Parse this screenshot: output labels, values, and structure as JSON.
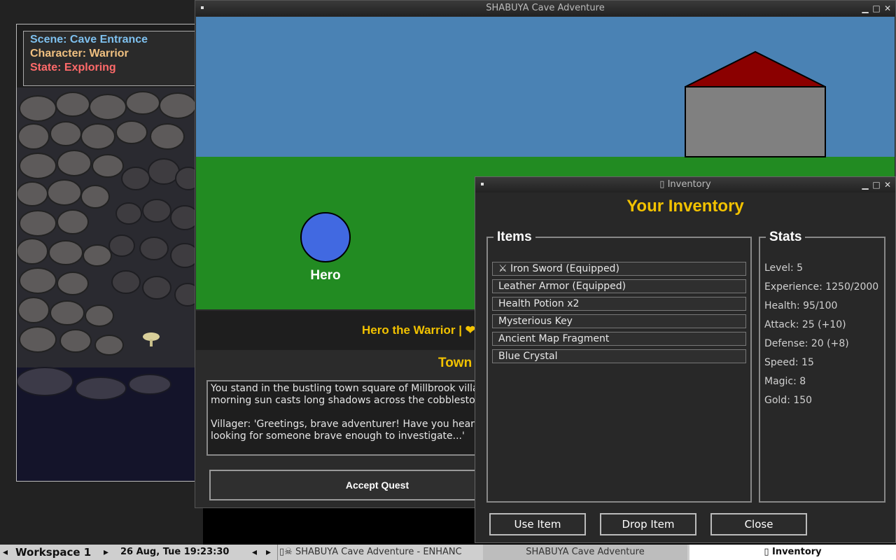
{
  "cave_panel": {
    "scene_line": "Scene: Cave Entrance",
    "character_line": "Character: Warrior",
    "state_line": "State: Exploring"
  },
  "main_window": {
    "title": "SHABUYA Cave Adventure",
    "hero_label": "Hero",
    "status_line": "Hero the Warrior | ❤",
    "location_title": "Town",
    "story_text": "You stand in the bustling town square of Millbrook villag\nmorning sun casts long shadows across the cobblestor\n\nVillager: 'Greetings, brave adventurer! Have you heard\nlooking for someone brave enough to investigate...'",
    "accept_button": "Accept Quest"
  },
  "inventory_window": {
    "title": "▯ Inventory",
    "heading": "Your Inventory",
    "items_legend": "Items",
    "items": [
      "⚔ Iron Sword (Equipped)",
      "Leather Armor (Equipped)",
      "Health Potion x2",
      "Mysterious Key",
      "Ancient Map Fragment",
      "Blue Crystal"
    ],
    "stats_legend": "Stats",
    "stats": [
      "Level: 5",
      "Experience: 1250/2000",
      "Health: 95/100",
      "Attack: 25 (+10)",
      "Defense: 20 (+8)",
      "Speed: 15",
      "Magic: 8",
      "Gold: 150"
    ],
    "use_button": "Use Item",
    "drop_button": "Drop Item",
    "close_button": "Close"
  },
  "taskbar": {
    "workspace": "Workspace 1",
    "clock": "26 Aug, Tue 19:23:30",
    "task1": "▯☠ SHABUYA Cave Adventure - ENHANC",
    "task2": "SHABUYA Cave Adventure",
    "task3": "▯ Inventory"
  },
  "colors": {
    "sky": "#4a82b4",
    "grass": "#228b22",
    "hero": "#4169e1",
    "house_wall": "#808080",
    "house_roof": "#8b0000",
    "accent_yellow": "#f2c200",
    "scene_blue": "#7ec0ee",
    "character_tan": "#f0c080",
    "state_red": "#ff6a6a"
  }
}
